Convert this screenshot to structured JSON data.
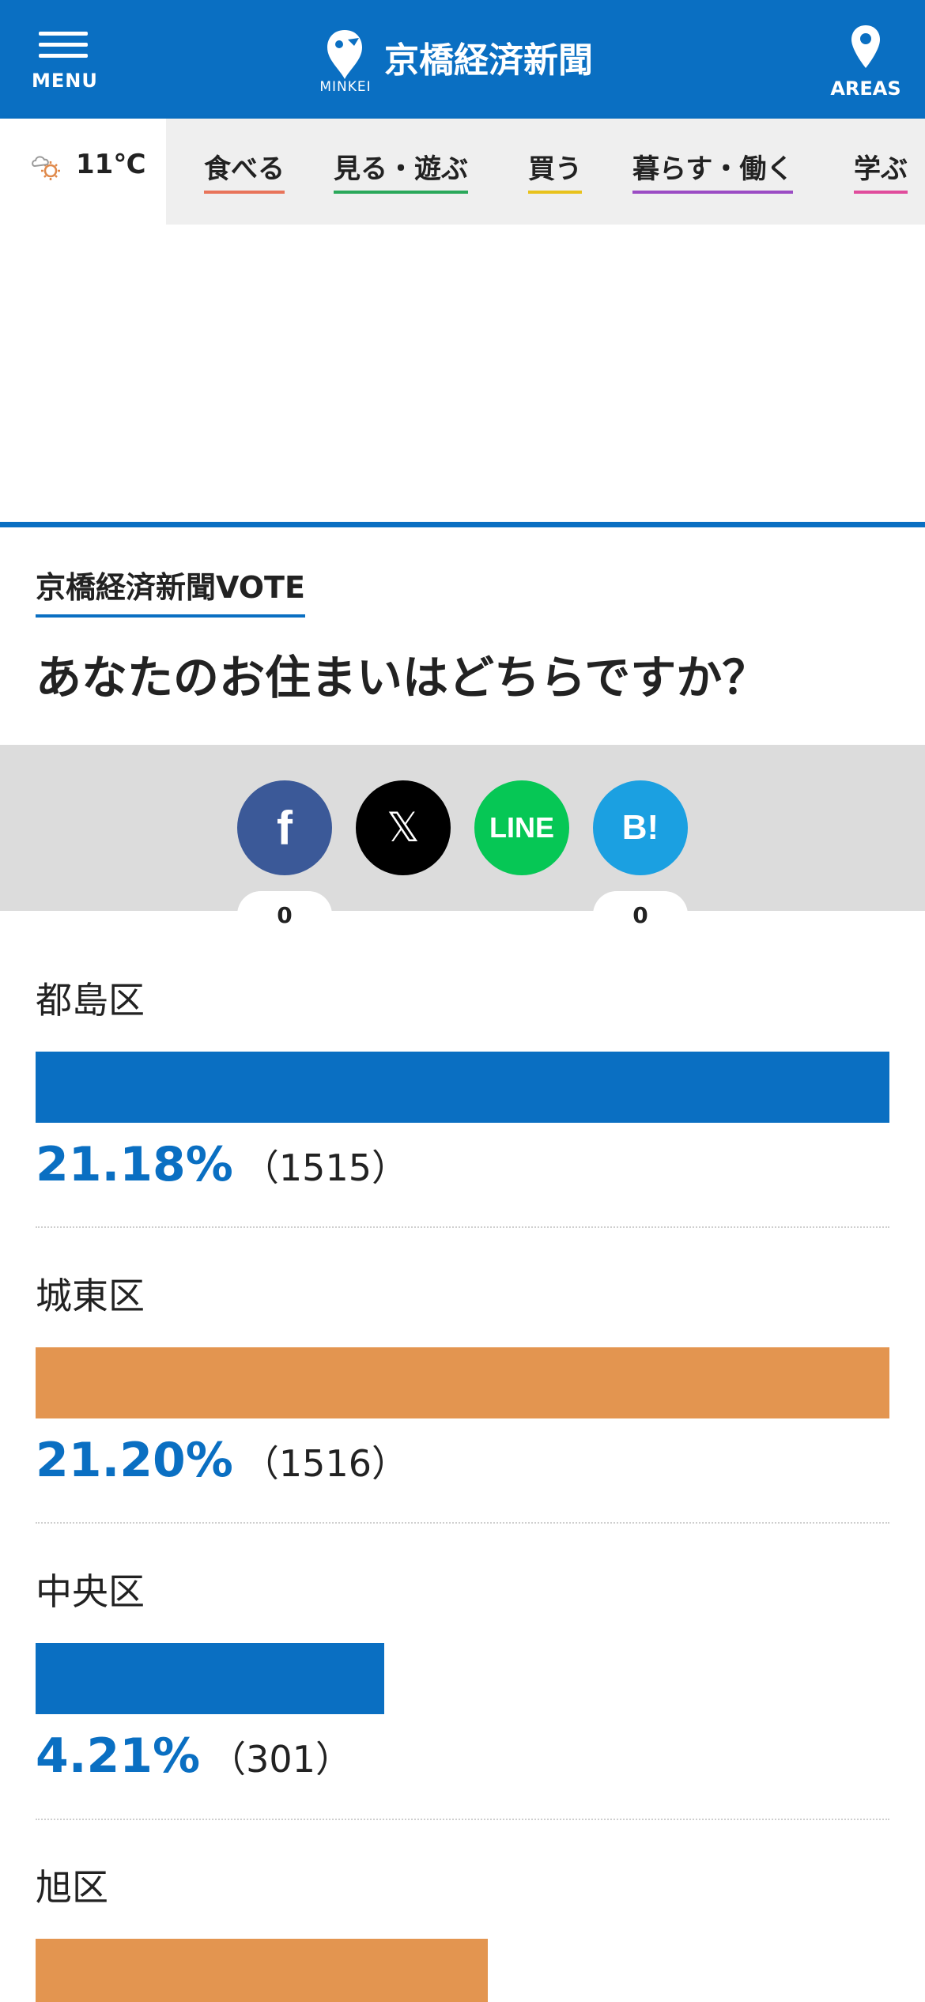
{
  "header": {
    "menu_label": "MENU",
    "logo_sub": "MINKEI",
    "site_title": "京橋経済新聞",
    "areas_label": "AREAS",
    "brand_color": "#0a6fc2"
  },
  "weather": {
    "icon": "cloudy-sun-icon",
    "temperature": "11℃"
  },
  "categories": [
    {
      "label": "食べる",
      "color": "#e8745a"
    },
    {
      "label": "見る・遊ぶ",
      "color": "#2aa85a"
    },
    {
      "label": "買う",
      "color": "#e8c21c"
    },
    {
      "label": "暮らす・働く",
      "color": "#9b4cc4"
    },
    {
      "label": "学ぶ",
      "color": "#e04c9c"
    }
  ],
  "vote": {
    "section_label": "京橋経済新聞VOTE",
    "question": "あなたのお住まいはどちらですか？"
  },
  "share": {
    "facebook_label": "f",
    "facebook_count": "0",
    "x_label": "𝕏",
    "line_label": "LINE",
    "hatena_label": "B!",
    "hatena_count": "0"
  },
  "options": [
    {
      "label": "都島区",
      "percent": "21.18%",
      "count": "（1515）",
      "fill": 1.0,
      "color": "#0a6fc2"
    },
    {
      "label": "城東区",
      "percent": "21.20%",
      "count": "（1516）",
      "fill": 1.0,
      "color": "#e39550"
    },
    {
      "label": "中央区",
      "percent": "4.21%",
      "count": "（301）",
      "fill": 0.408,
      "color": "#0a6fc2"
    },
    {
      "label": "旭区",
      "percent": "",
      "count": "",
      "fill": 0.53,
      "color": "#e39550"
    }
  ]
}
